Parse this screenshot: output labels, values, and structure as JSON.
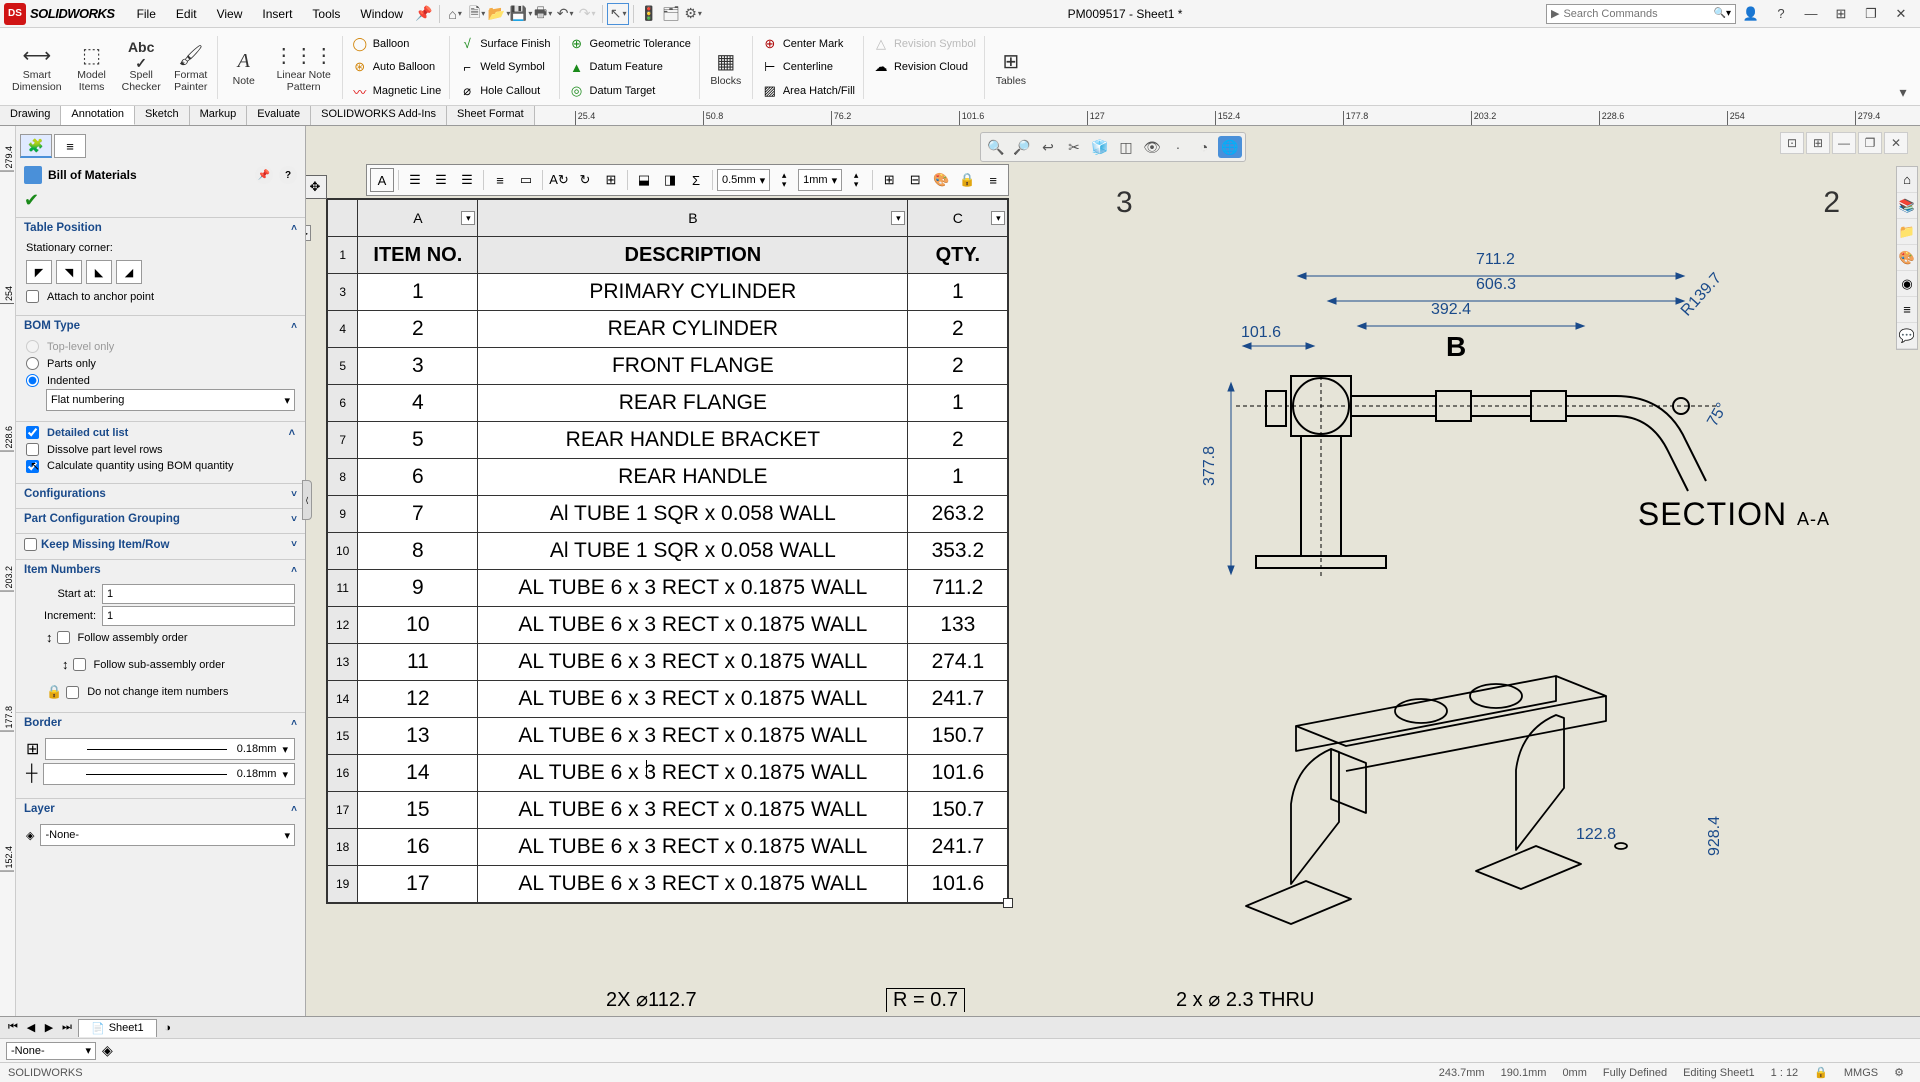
{
  "app": {
    "brand": "SOLIDWORKS",
    "menus": [
      "File",
      "Edit",
      "View",
      "Insert",
      "Tools",
      "Window"
    ],
    "doc_title": "PM009517 - Sheet1 *",
    "search_placeholder": "Search Commands"
  },
  "ribbon": {
    "big_buttons": [
      {
        "label": "Smart\nDimension",
        "icon": "↔"
      },
      {
        "label": "Model\nItems",
        "icon": "⬚"
      },
      {
        "label": "Spell\nChecker",
        "icon": "Abc"
      },
      {
        "label": "Format\nPainter",
        "icon": "🖌"
      },
      {
        "label": "Note",
        "icon": "A"
      },
      {
        "label": "Linear Note\nPattern",
        "icon": "⋮⋮"
      },
      {
        "label": "Blocks",
        "icon": "▦"
      },
      {
        "label": "Tables",
        "icon": "⊞"
      }
    ],
    "small_cols": [
      [
        {
          "label": "Balloon",
          "icon": "①"
        },
        {
          "label": "Auto Balloon",
          "icon": "⊙"
        },
        {
          "label": "Magnetic Line",
          "icon": "〰"
        }
      ],
      [
        {
          "label": "Surface Finish",
          "icon": "√"
        },
        {
          "label": "Weld Symbol",
          "icon": "⌐"
        },
        {
          "label": "Hole Callout",
          "icon": "⌀"
        }
      ],
      [
        {
          "label": "Geometric Tolerance",
          "icon": "⊕"
        },
        {
          "label": "Datum Feature",
          "icon": "▲"
        },
        {
          "label": "Datum Target",
          "icon": "◎"
        }
      ],
      [
        {
          "label": "Center Mark",
          "icon": "⊕"
        },
        {
          "label": "Centerline",
          "icon": "⊢"
        },
        {
          "label": "Area Hatch/Fill",
          "icon": "▨"
        }
      ],
      [
        {
          "label": "Revision Symbol",
          "icon": "△",
          "disabled": true
        },
        {
          "label": "Revision Cloud",
          "icon": "☁"
        },
        {
          "label": "",
          "icon": ""
        }
      ]
    ]
  },
  "tabs": [
    "Drawing",
    "Annotation",
    "Sketch",
    "Markup",
    "Evaluate",
    "SOLIDWORKS Add-Ins",
    "Sheet Format"
  ],
  "active_tab": 1,
  "ruler_ticks": [
    "25.4",
    "50.8",
    "76.2",
    "101.6",
    "127",
    "152.4",
    "177.8",
    "203.2",
    "228.6",
    "254",
    "279.4"
  ],
  "vruler_ticks": [
    "279.4",
    "254",
    "228.6",
    "203.2",
    "177.8",
    "152.4"
  ],
  "feature_panel": {
    "title": "Bill of Materials",
    "sections": {
      "table_position": {
        "title": "Table Position",
        "stationary_label": "Stationary corner:",
        "attach": "Attach to anchor point"
      },
      "bom_type": {
        "title": "BOM Type",
        "opt1": "Top-level only",
        "opt2": "Parts only",
        "opt3": "Indented",
        "indent_mode": "Flat numbering"
      },
      "detail": {
        "title": "Detailed cut list",
        "dissolve": "Dissolve part level rows",
        "calc": "Calculate quantity using BOM quantity"
      },
      "config": {
        "title": "Configurations"
      },
      "pcg": {
        "title": "Part Configuration Grouping"
      },
      "keep": {
        "title": "Keep Missing Item/Row"
      },
      "item_nums": {
        "title": "Item Numbers",
        "start": "Start at:",
        "start_val": "1",
        "incr": "Increment:",
        "incr_val": "1",
        "follow_asm": "Follow assembly order",
        "follow_sub": "Follow sub-assembly order",
        "no_change": "Do not change item numbers"
      },
      "border": {
        "title": "Border",
        "thickness": "0.18mm"
      },
      "layer": {
        "title": "Layer",
        "value": "-None-"
      }
    }
  },
  "bom": {
    "col_headers": [
      "A",
      "B",
      "C"
    ],
    "headers": [
      "ITEM NO.",
      "DESCRIPTION",
      "QTY."
    ],
    "rows": [
      [
        "1",
        "PRIMARY CYLINDER",
        "1"
      ],
      [
        "2",
        "REAR CYLINDER",
        "2"
      ],
      [
        "3",
        "FRONT FLANGE",
        "2"
      ],
      [
        "4",
        "REAR FLANGE",
        "1"
      ],
      [
        "5",
        "REAR HANDLE BRACKET",
        "2"
      ],
      [
        "6",
        "REAR HANDLE",
        "1"
      ],
      [
        "7",
        "Al TUBE 1 SQR x 0.058 WALL",
        "263.2"
      ],
      [
        "8",
        "Al TUBE 1 SQR x 0.058 WALL",
        "353.2"
      ],
      [
        "9",
        "AL TUBE 6 x 3 RECT x 0.1875 WALL",
        "711.2"
      ],
      [
        "10",
        "AL TUBE 6 x 3 RECT x 0.1875 WALL",
        "133"
      ],
      [
        "11",
        "AL TUBE 6 x 3 RECT x 0.1875 WALL",
        "274.1"
      ],
      [
        "12",
        "AL TUBE 6 x 3 RECT x 0.1875 WALL",
        "241.7"
      ],
      [
        "13",
        "AL TUBE 6 x 3 RECT x 0.1875 WALL",
        "150.7"
      ],
      [
        "14",
        "AL TUBE 6 x 3 RECT x 0.1875 WALL",
        "101.6"
      ],
      [
        "15",
        "AL TUBE 6 x 3 RECT x 0.1875 WALL",
        "150.7"
      ],
      [
        "16",
        "AL TUBE 6 x 3 RECT x 0.1875 WALL",
        "241.7"
      ],
      [
        "17",
        "AL TUBE 6 x 3 RECT x 0.1875 WALL",
        "101.6"
      ]
    ]
  },
  "fmt_toolbar": {
    "val1": "0.5mm",
    "val2": "1mm"
  },
  "drawing": {
    "zone3": "3",
    "zone2": "2",
    "dims": {
      "d711": "711.2",
      "d606": "606.3",
      "d392": "392.4",
      "d101": "101.6",
      "bB": "B",
      "d377": "377.8",
      "r139": "R139.7",
      "a75": "75°",
      "d122": "122.8",
      "d928": "928.4"
    },
    "section": "SECTION",
    "section_sub": "A-A",
    "notes1": "2X ⌀112.7",
    "notes2": "2 x ⌀ 2.3 THRU",
    "notes3": "R = 0.7"
  },
  "sheet_tab": "Sheet1",
  "layer_current": "-None-",
  "status": {
    "app": "SOLIDWORKS",
    "x": "243.7mm",
    "y": "190.1mm",
    "z": "0mm",
    "defined": "Fully Defined",
    "editing": "Editing Sheet1",
    "scale": "1 : 12",
    "units": "MMGS"
  },
  "right_vruler": [
    "928.4"
  ]
}
